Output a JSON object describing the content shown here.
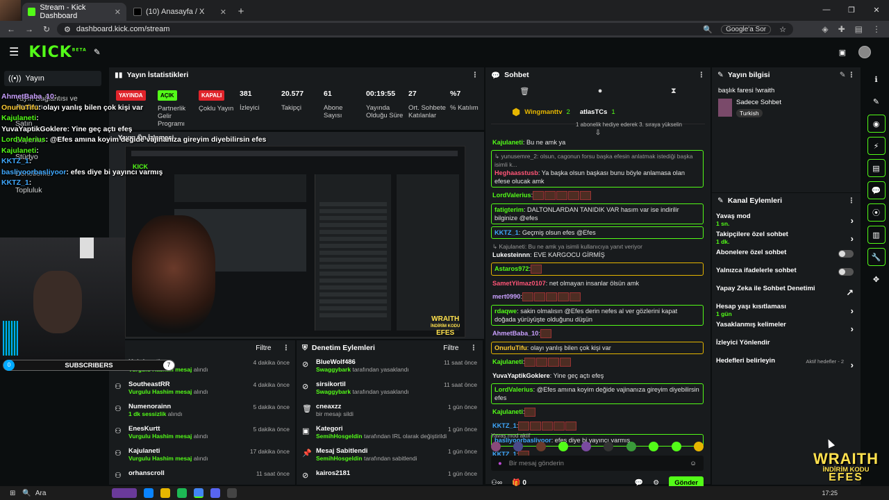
{
  "browser": {
    "tabs": [
      {
        "title": "Stream - Kick Dashboard",
        "active": true
      },
      {
        "title": "(10) Anasayfa / X",
        "active": false
      }
    ],
    "url": "dashboard.kick.com/stream",
    "google_button": "Google'a Sor"
  },
  "header": {
    "logo": "KICK",
    "logo_sup": "BETA"
  },
  "sidebar": {
    "yayin": "Yayın",
    "items": [
      "Yayın Bağlantısı ve Anahtarı",
      "Satın",
      "Başarılar",
      "Stüdyo",
      "Denetleme",
      "Topluluk"
    ]
  },
  "overlay_chat": [
    {
      "user": "AhmetBaba_10",
      "color": "#c9a0ff",
      "text": ":"
    },
    {
      "user": "OnurluTifu",
      "color": "#ffcc33",
      "text": ": olayı yanlış bilen çok kişi var"
    },
    {
      "user": "Kajulaneti",
      "color": "#53fc18",
      "text": ":"
    },
    {
      "user": "YuvaYaptikGoklere",
      "color": "#ffffff",
      "text": ": Yine geç açtı efeş"
    },
    {
      "user": "LordValerius",
      "color": "#53fc18",
      "text": ": @Efes amına koyim değide vajinanıza gireyim diyebilirsin efes"
    },
    {
      "user": "Kajulaneti",
      "color": "#53fc18",
      "text": ":"
    },
    {
      "user": "KKTZ_1",
      "color": "#3fa9ff",
      "text": ":"
    },
    {
      "user": "basliyoorbasliyoor",
      "color": "#3fa9ff",
      "text": ": efes diye bi yayıncı varmış"
    },
    {
      "user": "KKTZ_1",
      "color": "#3fa9ff",
      "text": ":"
    }
  ],
  "subscribers": {
    "label": "SUBSCRIBERS",
    "count": "0",
    "goal": "7"
  },
  "stats": {
    "title": "Yayın İstatistikleri",
    "badges": [
      {
        "label": "YAYINDA",
        "sub": "",
        "color": "#e0242b"
      },
      {
        "label": "AÇIK",
        "sub": "Partnerlik Gelir Programı",
        "color": "#53fc18"
      },
      {
        "label": "KAPALI",
        "sub": "Çoklu Yayın",
        "color": "#e0242b"
      }
    ],
    "values": [
      {
        "value": "381",
        "label": "İzleyici"
      },
      {
        "value": "20.577",
        "label": "Takipçi"
      },
      {
        "value": "61",
        "label": "Abone Sayısı"
      },
      {
        "value": "00:19:55",
        "label": "Yayında Olduğu Süre"
      },
      {
        "value": "27",
        "label": "Ort. Sohbete Katılanlar"
      },
      {
        "value": "%7",
        "label": "% Katılım"
      }
    ]
  },
  "preview": {
    "title": "Yayın Ön İzlemesi",
    "wraith": "WRAITH",
    "wraith_sub": "İNDİRİM KODU",
    "wraith_code": "EFES"
  },
  "events": {
    "title": "",
    "filter": "Filtre",
    "items": [
      {
        "name": "Kajulaneti",
        "who": "Swaggybark",
        "action": "Vurgulu Hashim mesaj",
        "rest": "alındı",
        "time": "4 dakika önce"
      },
      {
        "name": "SoutheastRR",
        "who": "",
        "action": "Vurgulu Hashim mesaj",
        "rest": "alındı",
        "time": "4 dakika önce"
      },
      {
        "name": "Numenorainn",
        "who": "",
        "action": "1 dk sessizlik",
        "rest": "alındı",
        "time": "5 dakika önce"
      },
      {
        "name": "EnesKurtt",
        "who": "",
        "action": "Vurgulu Hashim mesaj",
        "rest": "alındı",
        "time": "5 dakika önce"
      },
      {
        "name": "Kajulaneti",
        "who": "",
        "action": "Vurgulu Hashim mesaj",
        "rest": "alındı",
        "time": "17 dakika önce"
      },
      {
        "name": "orhanscroll",
        "who": "",
        "action": "",
        "rest": "",
        "time": "11 saat önce"
      }
    ]
  },
  "moderation": {
    "title": "Denetim Eylemleri",
    "filter": "Filtre",
    "items": [
      {
        "name": "BlueWolf486",
        "who": "Swaggybark",
        "rest": "tarafından yasaklandı",
        "time": "11 saat önce",
        "icon": "⊘"
      },
      {
        "name": "sirsikortil",
        "who": "Swaggybark",
        "rest": "tarafından yasaklandı",
        "time": "11 saat önce",
        "icon": "⊘"
      },
      {
        "name": "cneaxzz",
        "who": "",
        "rest": "bir mesajı sildi",
        "time": "1 gün önce",
        "icon": "🗑"
      },
      {
        "name": "Kategori",
        "who": "SemihHosgeldin",
        "rest": "tarafından IRL olarak değiştirildi",
        "time": "1 gün önce",
        "icon": "▣"
      },
      {
        "name": "Mesaj Sabitlendi",
        "who": "SemihHosgeldin",
        "rest": "tarafından sabitlendi",
        "time": "1 gün önce",
        "icon": "📌"
      },
      {
        "name": "kairos2181",
        "who": "",
        "rest": "",
        "time": "1 gün önce",
        "icon": "⊘"
      }
    ]
  },
  "chat": {
    "title": "Sohbet",
    "pinned": {
      "user1": "Wingmanttv",
      "user2": "atlasTCs",
      "note": "1 abonelik hediye ederek 3. sıraya yükselin",
      "num1": "2",
      "num2": "1"
    },
    "messages": [
      {
        "type": "plain",
        "user": "Kajulaneti",
        "color": "#53fc18",
        "text": ": Bu ne amk ya"
      },
      {
        "type": "hl",
        "reply": "↳ yunusemre_2: olsun, cagonun forsu başka efesin anlatmak istediği başka isimli k...",
        "user": "Heghaasstusb",
        "color": "#ff5577",
        "text": ": Ya başka olsun başkası bunu böyle anlamasa olan efese olucak amk"
      },
      {
        "type": "plain",
        "user": "LordValerius",
        "color": "#53fc18",
        "text": ":",
        "emotes": 5
      },
      {
        "type": "hl",
        "user": "fatigterim",
        "color": "#53fc18",
        "text": ": DALTONLARDAN TANIDIK VAR hasım var ise indirilir bilginize @efes"
      },
      {
        "type": "hl",
        "user": "KKTZ_1",
        "color": "#3fa9ff",
        "text": ": Geçmiş olsun efes @Efes"
      },
      {
        "type": "plain",
        "reply": "↳ Kajulaneti: Bu ne amk ya isimli kullanıcıya yanıt veriyor",
        "user": "Lukesteinnn",
        "color": "#ffffff",
        "text": ": EVE KARGOCU GİRMİŞ"
      },
      {
        "type": "gold",
        "user": "Astaros972",
        "color": "#53fc18",
        "text": ":",
        "emotes": 1
      },
      {
        "type": "plain",
        "user": "SametYilmaz0107",
        "color": "#ff5577",
        "text": ": net olmayan insanlar ölsün amk"
      },
      {
        "type": "plain",
        "user": "mert0990",
        "color": "#c9a0ff",
        "text": ":",
        "emotes": 5
      },
      {
        "type": "hl",
        "user": "rdaqwe",
        "color": "#53fc18",
        "text": ": sakin olmalısın @Efes derin nefes al ver gözlerini kapat doğada yürüyüşte olduğunu düşün"
      },
      {
        "type": "plain",
        "user": "AhmetBaba_10",
        "color": "#c9a0ff",
        "text": ":",
        "emotes": 1
      },
      {
        "type": "gold",
        "user": "OnurluTifu",
        "color": "#ffcc33",
        "text": ": olayı yanlış bilen çok kişi var"
      },
      {
        "type": "plain",
        "user": "Kajulaneti",
        "color": "#53fc18",
        "text": ":",
        "emotes": 4
      },
      {
        "type": "plain",
        "user": "YuvaYaptikGoklere",
        "color": "#ffffff",
        "text": ": Yine geç açtı efeş"
      },
      {
        "type": "hl",
        "user": "LordValerius",
        "color": "#53fc18",
        "text": ": @Efes amına koyim değide vajinanıza gireyim diyebilirsin efes"
      },
      {
        "type": "plain",
        "user": "Kajulaneti",
        "color": "#53fc18",
        "text": ":",
        "emotes": 1
      },
      {
        "type": "plain",
        "user": "KKTZ_1",
        "color": "#3fa9ff",
        "text": ":",
        "emotes": 5
      },
      {
        "type": "hl",
        "user": "basliyoorbasliyoor",
        "color": "#3fa9ff",
        "text": ": efes diye bi yayıncı varmış"
      },
      {
        "type": "plain",
        "user": "KKTZ_1",
        "color": "#3fa9ff",
        "text": ":",
        "emotes": 1
      }
    ],
    "mod_label": "Yavaş mod aktif",
    "input_placeholder": "Bir mesaj gönderin",
    "gift_count": "0",
    "send_label": "Gönder"
  },
  "info": {
    "title": "Yayın bilgisi",
    "stream_title": "başlık faresi !wraith",
    "category": "Sadece Sohbet",
    "language": "Turkish"
  },
  "actions": {
    "title": "Kanal Eylemleri",
    "items": [
      {
        "label": "Yavaş mod",
        "sub": "1 sn.",
        "kind": "chev"
      },
      {
        "label": "Takipçilere özel sohbet",
        "sub": "1 dk.",
        "kind": "chev"
      },
      {
        "label": "Abonelere özel sohbet",
        "sub": "",
        "kind": "toggle"
      },
      {
        "label": "Yalnızca ifadelerle sohbet",
        "sub": "",
        "kind": "toggle"
      },
      {
        "label": "Yapay Zeka ile Sohbet Denetimi",
        "sub": "",
        "kind": "ext"
      },
      {
        "label": "Hesap yaşı kısıtlaması",
        "sub": "1 gün",
        "kind": "chev"
      },
      {
        "label": "Yasaklanmış kelimeler",
        "sub": "",
        "kind": "chev"
      },
      {
        "label": "İzleyici Yönlendir",
        "sub": "",
        "kind": "none"
      },
      {
        "label": "Hedefleri belirleyin",
        "sub": "",
        "kind": "goal",
        "extra": "Aktif hedefler - 2"
      }
    ]
  },
  "taskbar": {
    "search": "Ara",
    "time": "17:25"
  },
  "brand_colors": {
    "kick_green": "#53fc18",
    "live_red": "#e0242b",
    "wraith_yellow": "#ffe14d"
  }
}
